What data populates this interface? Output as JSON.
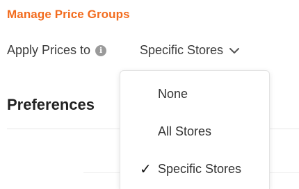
{
  "header": {
    "manage_link": "Manage Price Groups"
  },
  "apply_prices": {
    "label": "Apply Prices to",
    "info_icon": "info-icon",
    "selected": "Specific Stores"
  },
  "preferences": {
    "heading": "Preferences"
  },
  "dropdown": {
    "options": [
      {
        "label": "None",
        "checked": false
      },
      {
        "label": "All Stores",
        "checked": false
      },
      {
        "label": "Specific Stores",
        "checked": true
      }
    ],
    "check_glyph": "✓"
  },
  "colors": {
    "accent": "#f26b1d"
  }
}
